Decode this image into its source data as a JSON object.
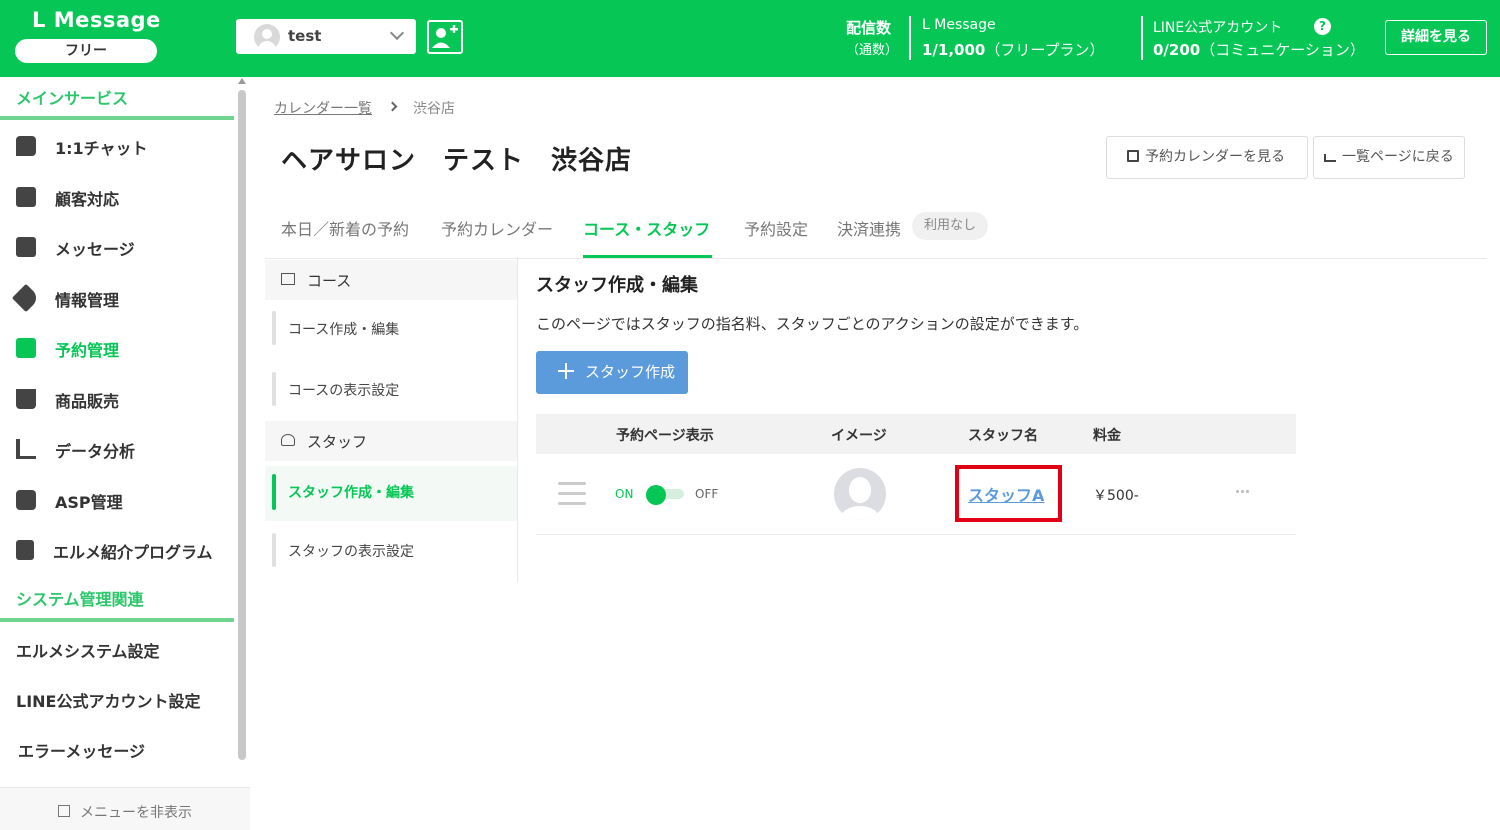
{
  "header": {
    "app_title": "L Message",
    "plan": "フリー",
    "account_name": "test",
    "delivery_label": "配信数",
    "delivery_sub": "（通数）",
    "lmessage_label": "L Message",
    "lmessage_value": "1/1,000",
    "lmessage_plan": "（フリープラン）",
    "line_label": "LINE公式アカウント",
    "line_value": "0/200",
    "line_plan": "（コミュニケーション）",
    "help": "?",
    "detail_button": "詳細を見る"
  },
  "sidebar": {
    "main_section": "メインサービス",
    "items": [
      {
        "label": "1:1チャット",
        "icon": "chat-icon"
      },
      {
        "label": "顧客対応",
        "icon": "arrow-out-icon"
      },
      {
        "label": "メッセージ",
        "icon": "pencil-icon"
      },
      {
        "label": "情報管理",
        "icon": "tag-icon"
      },
      {
        "label": "予約管理",
        "icon": "calendar-icon"
      },
      {
        "label": "商品販売",
        "icon": "cart-icon"
      },
      {
        "label": "データ分析",
        "icon": "chart-icon"
      },
      {
        "label": "ASP管理",
        "icon": "asp-icon"
      },
      {
        "label": "エルメ紹介プログラム",
        "icon": "clipboard-icon"
      }
    ],
    "system_section": "システム管理関連",
    "system_items": [
      "エルメシステム設定",
      "LINE公式アカウント設定",
      "エラーメッセージ"
    ],
    "collapse_label": "メニューを非表示"
  },
  "breadcrumb": {
    "parent": "カレンダー一覧",
    "current": "渋谷店"
  },
  "page_title": "ヘアサロン　テスト　渋谷店",
  "actions": {
    "view_calendar": "予約カレンダーを見る",
    "back_to_list": "一覧ページに戻る"
  },
  "tabs": [
    "本日／新着の予約",
    "予約カレンダー",
    "コース・スタッフ",
    "予約設定",
    "決済連携"
  ],
  "tab_badge": "利用なし",
  "subnav": {
    "course_header": "コース",
    "course_items": [
      "コース作成・編集",
      "コースの表示設定"
    ],
    "staff_header": "スタッフ",
    "staff_items": [
      "スタッフ作成・編集",
      "スタッフの表示設定"
    ]
  },
  "content": {
    "title": "スタッフ作成・編集",
    "description": "このページではスタッフの指名料、スタッフごとのアクションの設定ができます。",
    "create_button": "スタッフ作成",
    "columns": [
      "予約ページ表示",
      "イメージ",
      "スタッフ名",
      "料金"
    ],
    "rows": [
      {
        "on_label": "ON",
        "off_label": "OFF",
        "display": "ON",
        "staff_name": "スタッフA",
        "price": "￥500-"
      }
    ]
  },
  "colors": {
    "brand": "#06c755",
    "link": "#5b9bdc",
    "highlight": "#e00012"
  }
}
